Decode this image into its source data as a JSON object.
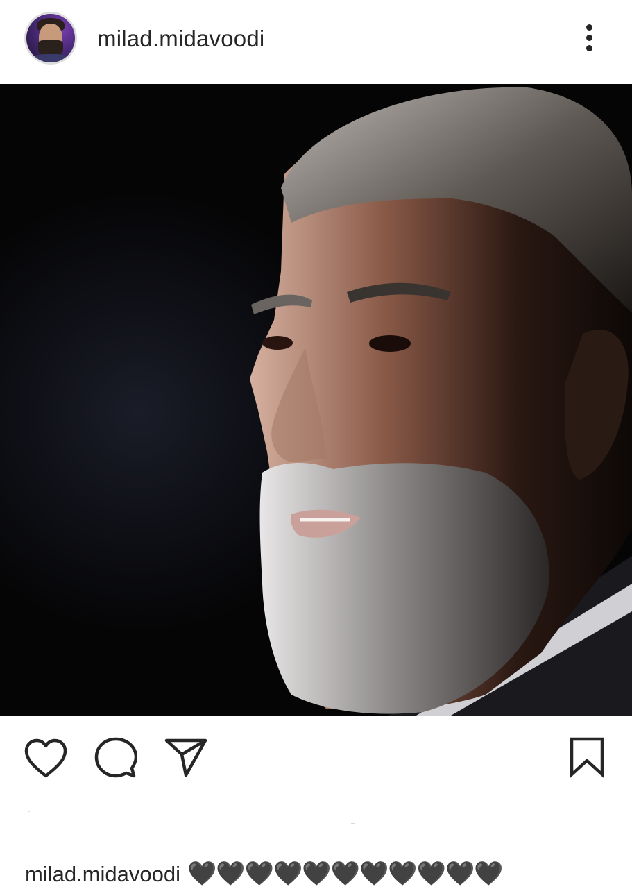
{
  "post": {
    "username": "milad.midavoodi",
    "menu_icon": "more-vertical-icon",
    "avatar_icon": "profile-avatar",
    "photo_description_icon": "post-photo",
    "actions": {
      "like_icon": "heart-outline-icon",
      "comment_icon": "comment-bubble-icon",
      "share_icon": "paper-plane-icon",
      "save_icon": "bookmark-outline-icon"
    },
    "caption": {
      "username": "milad.midavoodi",
      "text": "🖤🖤🖤🖤🖤🖤🖤🖤🖤🖤🖤"
    }
  },
  "colors": {
    "text": "#262626",
    "background": "#ffffff",
    "photo_background": "#050506"
  }
}
